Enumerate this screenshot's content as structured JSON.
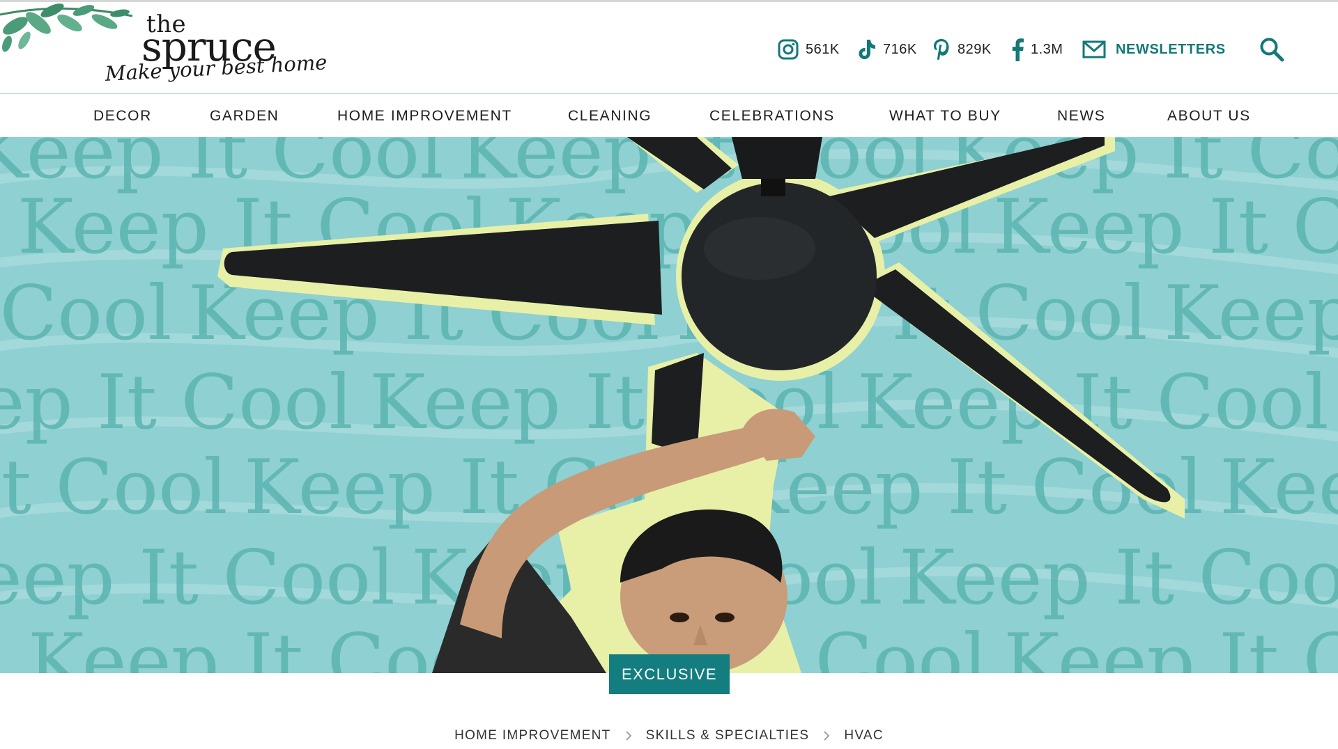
{
  "brand": {
    "logo_word_top": "the",
    "logo_word_main": "spruce",
    "tagline": "Make your best home"
  },
  "social": {
    "instagram": {
      "icon": "instagram-icon",
      "count": "561K"
    },
    "tiktok": {
      "icon": "tiktok-icon",
      "count": "716K"
    },
    "pinterest": {
      "icon": "pinterest-icon",
      "count": "829K"
    },
    "facebook": {
      "icon": "facebook-icon",
      "count": "1.3M"
    },
    "newsletters": {
      "icon": "mail-icon",
      "label": "NEWSLETTERS"
    }
  },
  "search": {
    "icon": "search-icon"
  },
  "nav": {
    "items": [
      {
        "label": "DECOR"
      },
      {
        "label": "GARDEN"
      },
      {
        "label": "HOME IMPROVEMENT"
      },
      {
        "label": "CLEANING"
      },
      {
        "label": "CELEBRATIONS"
      },
      {
        "label": "WHAT TO BUY"
      },
      {
        "label": "NEWS"
      },
      {
        "label": "ABOUT US"
      }
    ]
  },
  "hero": {
    "pattern_text": "Keep It Cool",
    "badge": "EXCLUSIVE"
  },
  "breadcrumb": {
    "items": [
      {
        "label": "HOME IMPROVEMENT"
      },
      {
        "label": "SKILLS & SPECIALTIES"
      },
      {
        "label": "HVAC"
      }
    ]
  },
  "colors": {
    "accent": "#127878",
    "badge_bg": "#137d80",
    "hero_bg": "#8fd0d2",
    "hero_text": "#5bb4b0",
    "fan_outline": "#e8f0a8"
  }
}
